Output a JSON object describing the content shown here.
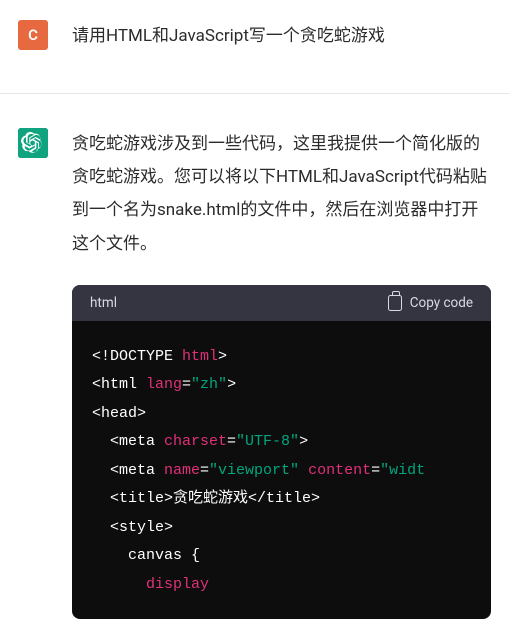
{
  "user": {
    "avatar_letter": "C",
    "message": "请用HTML和JavaScript写一个贪吃蛇游戏"
  },
  "assistant": {
    "message": "贪吃蛇游戏涉及到一些代码，这里我提供一个简化版的贪吃蛇游戏。您可以将以下HTML和JavaScript代码粘贴到一个名为snake.html的文件中，然后在浏览器中打开这个文件。"
  },
  "code": {
    "lang_label": "html",
    "copy_label": "Copy code",
    "tokens": {
      "t01": "<!DOCTYPE ",
      "t02": "html",
      "t03": ">",
      "t04": "<html ",
      "t05": "lang",
      "t06": "=",
      "t07": "\"zh\"",
      "t08": ">",
      "t09": "<head>",
      "t10": "  <meta ",
      "t11": "charset",
      "t12": "=",
      "t13": "\"UTF-8\"",
      "t14": ">",
      "t15": "  <meta ",
      "t16": "name",
      "t17": "=",
      "t18": "\"viewport\"",
      "t19": " ",
      "t20": "content",
      "t21": "=",
      "t22": "\"widt",
      "t23": "  <title>贪吃蛇游戏</title>",
      "t24": "  <style>",
      "t25": "    canvas {",
      "t26": "      display"
    }
  }
}
